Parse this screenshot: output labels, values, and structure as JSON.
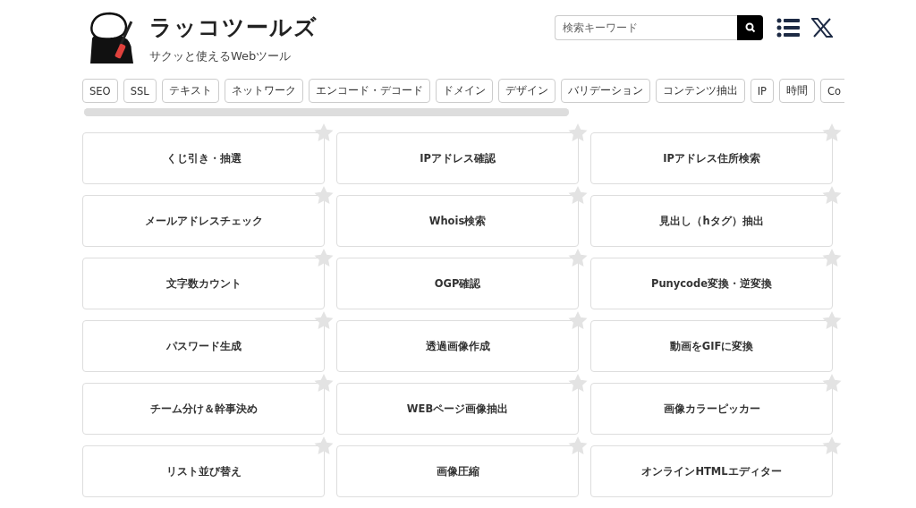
{
  "site": {
    "title": "ラッコツールズ",
    "tagline": "サクッと使えるWebツール"
  },
  "search": {
    "placeholder": "検索キーワード"
  },
  "categories": [
    "SEO",
    "SSL",
    "テキスト",
    "ネットワーク",
    "エンコード・デコード",
    "ドメイン",
    "デザイン",
    "バリデーション",
    "コンテンツ抽出",
    "IP",
    "時間",
    "Co"
  ],
  "tools": [
    "くじ引き・抽選",
    "IPアドレス確認",
    "IPアドレス住所検索",
    "メールアドレスチェック",
    "Whois検索",
    "見出し（hタグ）抽出",
    "文字数カウント",
    "OGP確認",
    "Punycode変換・逆変換",
    "パスワード生成",
    "透過画像作成",
    "動画をGIFに変換",
    "チーム分け＆幹事決め",
    "WEBページ画像抽出",
    "画像カラーピッカー",
    "リスト並び替え",
    "画像圧縮",
    "オンラインHTMLエディター"
  ]
}
